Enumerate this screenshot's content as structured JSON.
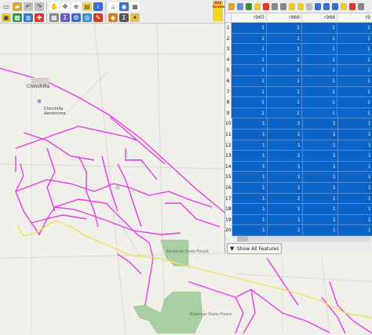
{
  "toolbar": {
    "row1": [
      {
        "icon": "new-project-icon",
        "color": "#e8e8e8",
        "glyph": "▭"
      },
      {
        "icon": "open-project-icon",
        "color": "#d9a73a",
        "glyph": "▰"
      },
      {
        "icon": "undo-icon",
        "color": "#bfbfbf",
        "glyph": "↶"
      },
      {
        "icon": "redo-icon",
        "color": "#bfbfbf",
        "glyph": "↷"
      },
      {
        "icon": "pan-map-icon",
        "color": "#ffffff",
        "glyph": "✋"
      },
      {
        "icon": "pan-to-selection-icon",
        "color": "#ffffff",
        "glyph": "✥"
      },
      {
        "icon": "zoom-in-icon",
        "color": "#ffffff",
        "glyph": "⊕"
      },
      {
        "icon": "select-features-icon",
        "color": "#f2d14a",
        "glyph": "▤"
      },
      {
        "icon": "identify-icon",
        "color": "#3b6ed1",
        "glyph": "i"
      },
      {
        "icon": "measure-icon",
        "color": "#ffffff",
        "glyph": "⟂"
      },
      {
        "icon": "python-console-icon",
        "color": "#3b6ed1",
        "glyph": "◉"
      },
      {
        "icon": "open-table-icon",
        "color": "#ffffff",
        "glyph": "▦"
      }
    ],
    "row2": [
      {
        "icon": "add-vector-layer-icon",
        "color": "#e9c840",
        "glyph": "▣"
      },
      {
        "icon": "add-raster-layer-icon",
        "color": "#2c9a3a",
        "glyph": "▩"
      },
      {
        "icon": "add-wms-layer-icon",
        "color": "#2b7bd8",
        "glyph": "◍"
      },
      {
        "icon": "add-csv-layer-icon",
        "color": "#d83b2b",
        "glyph": "✚"
      },
      {
        "icon": "field-calculator-icon",
        "color": "#888888",
        "glyph": "▦"
      },
      {
        "icon": "statistics-icon",
        "color": "#6a5acd",
        "glyph": "Σ"
      },
      {
        "icon": "processing-toolbox-icon",
        "color": "#3b6ed1",
        "glyph": "⚙"
      },
      {
        "icon": "globe-icon",
        "color": "#3b8fd1",
        "glyph": "◎"
      },
      {
        "icon": "digitize-icon",
        "color": "#d83b2b",
        "glyph": "✎"
      },
      {
        "icon": "atlas-icon",
        "color": "#e07b1a",
        "glyph": "◆"
      },
      {
        "icon": "sum-icon",
        "color": "#555555",
        "glyph": "Σ"
      },
      {
        "icon": "tip-icon",
        "color": "#e3c04a",
        "glyph": "✦"
      }
    ],
    "badge": "ARA Enable"
  },
  "table": {
    "toolbar_icons": [
      "toggle-editing-icon",
      "save-edits-icon",
      "reload-icon",
      "add-feature-icon",
      "delete-feature-icon",
      "copy-icon",
      "paste-icon",
      "select-all-icon",
      "invert-selection-icon",
      "deselect-icon",
      "filter-icon",
      "pan-to-selected-icon",
      "zoom-to-selected-icon",
      "new-field-icon",
      "delete-field-icon",
      "field-calculator-icon"
    ],
    "columns": [
      "r965",
      "r966",
      "r968",
      "r9"
    ],
    "rows": [
      {
        "n": "1",
        "c": [
          "1",
          "1",
          "1",
          "1"
        ]
      },
      {
        "n": "2",
        "c": [
          "1",
          "1",
          "1",
          "1"
        ]
      },
      {
        "n": "3",
        "c": [
          "1",
          "1",
          "1",
          "1"
        ]
      },
      {
        "n": "4",
        "c": [
          "1",
          "1",
          "1",
          "1"
        ]
      },
      {
        "n": "5",
        "c": [
          "1",
          "1",
          "1",
          "1"
        ]
      },
      {
        "n": "6",
        "c": [
          "1",
          "1",
          "1",
          "1"
        ]
      },
      {
        "n": "7",
        "c": [
          "1",
          "1",
          "1",
          "1"
        ]
      },
      {
        "n": "8",
        "c": [
          "1",
          "1",
          "1",
          "1"
        ]
      },
      {
        "n": "9",
        "c": [
          "1",
          "1",
          "1",
          "1"
        ]
      },
      {
        "n": "10",
        "c": [
          "1",
          "1",
          "1",
          "1"
        ]
      },
      {
        "n": "11",
        "c": [
          "1",
          "1",
          "1",
          "1"
        ]
      },
      {
        "n": "12",
        "c": [
          "1",
          "1",
          "1",
          "1"
        ]
      },
      {
        "n": "13",
        "c": [
          "1",
          "1",
          "1",
          "1"
        ]
      },
      {
        "n": "14",
        "c": [
          "1",
          "1",
          "1",
          "1"
        ]
      },
      {
        "n": "15",
        "c": [
          "1",
          "1",
          "1",
          "1"
        ]
      },
      {
        "n": "16",
        "c": [
          "1",
          "1",
          "1",
          "1"
        ]
      },
      {
        "n": "17",
        "c": [
          "1",
          "1",
          "1",
          "1"
        ]
      },
      {
        "n": "18",
        "c": [
          "1",
          "1",
          "1",
          "1"
        ]
      },
      {
        "n": "19",
        "c": [
          "1",
          "1",
          "1",
          "1"
        ]
      },
      {
        "n": "20",
        "c": [
          "1",
          "1",
          "1",
          "1"
        ]
      }
    ],
    "show_all_label": "Show All Features"
  },
  "map": {
    "town_label": "Chinchilla",
    "aerodrome_label": "Chinchilla Aerodrome",
    "forest_label_1": "Barakula State Forest",
    "forest_label_2": "Braemar State Forest",
    "colors": {
      "network": "#e83ce8",
      "highlight": "#e9e35a",
      "forest": "#a9cfa3",
      "background": "#f1efe9"
    }
  }
}
